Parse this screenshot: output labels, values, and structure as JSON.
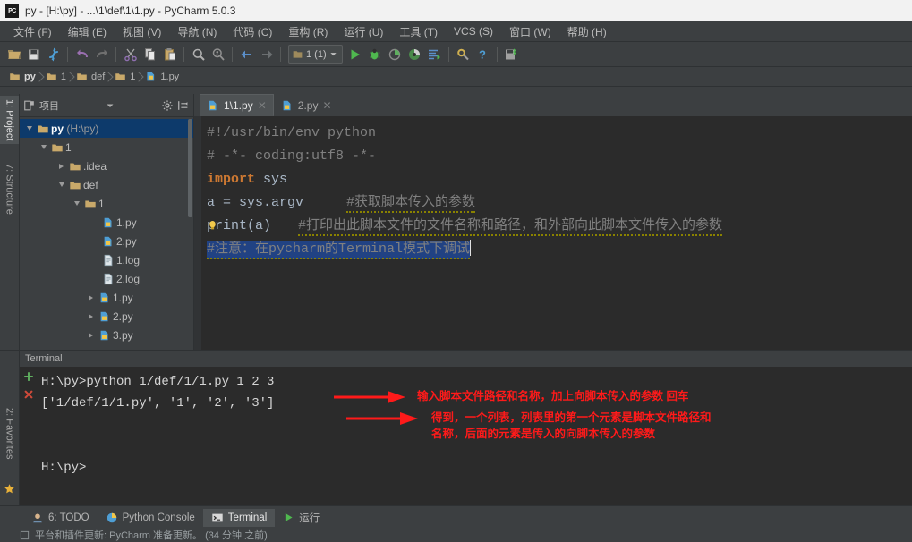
{
  "window": {
    "title": "py - [H:\\py] - ...\\1\\def\\1\\1.py - PyCharm 5.0.3",
    "logo_text": "PC"
  },
  "menu": {
    "items": [
      {
        "label": "文件 (F)",
        "name": "menu-file"
      },
      {
        "label": "编辑 (E)",
        "name": "menu-edit"
      },
      {
        "label": "视图 (V)",
        "name": "menu-view"
      },
      {
        "label": "导航 (N)",
        "name": "menu-navigate"
      },
      {
        "label": "代码 (C)",
        "name": "menu-code"
      },
      {
        "label": "重构 (R)",
        "name": "menu-refactor"
      },
      {
        "label": "运行 (U)",
        "name": "menu-run"
      },
      {
        "label": "工具 (T)",
        "name": "menu-tools"
      },
      {
        "label": "VCS (S)",
        "name": "menu-vcs"
      },
      {
        "label": "窗口 (W)",
        "name": "menu-window"
      },
      {
        "label": "帮助 (H)",
        "name": "menu-help"
      }
    ]
  },
  "toolbar": {
    "run_config_label": "1 (1)",
    "icons": [
      "open-folder-icon",
      "save-all-icon",
      "sync-icon",
      "undo-icon",
      "redo-icon",
      "cut-icon",
      "copy-icon",
      "paste-icon",
      "find-icon",
      "find-usages-icon",
      "back-icon",
      "forward-icon"
    ],
    "run_icons": [
      "run-icon",
      "debug-icon",
      "coverage-icon",
      "profile-icon",
      "run-with-console-icon",
      "settings-icon",
      "help-icon",
      "update-icon"
    ]
  },
  "breadcrumb": {
    "items": [
      {
        "label": "py",
        "icon": "folder-icon",
        "bold": true
      },
      {
        "label": "1",
        "icon": "folder-icon",
        "bold": false
      },
      {
        "label": "def",
        "icon": "folder-icon",
        "bold": false
      },
      {
        "label": "1",
        "icon": "folder-icon",
        "bold": false
      },
      {
        "label": "1.py",
        "icon": "python-file-icon",
        "bold": false
      }
    ]
  },
  "left_strip": {
    "tabs": [
      {
        "label": "1: Project",
        "selected": true,
        "name": "tool-tab-project"
      },
      {
        "label": "7: Structure",
        "selected": false,
        "name": "tool-tab-structure"
      },
      {
        "label": "2: Favorites",
        "selected": false,
        "name": "tool-tab-favorites"
      }
    ]
  },
  "project_panel": {
    "title": "项目",
    "tree": [
      {
        "label": "py",
        "suffix": " (H:\\py)",
        "depth": 0,
        "arrow": "open",
        "icon": "folder-icon",
        "selected": true,
        "bold": true
      },
      {
        "label": "1",
        "suffix": "",
        "depth": 1,
        "arrow": "open",
        "icon": "folder-icon",
        "selected": false,
        "bold": false
      },
      {
        "label": ".idea",
        "suffix": "",
        "depth": 2,
        "arrow": "closed",
        "icon": "folder-icon",
        "selected": false,
        "bold": false
      },
      {
        "label": "def",
        "suffix": "",
        "depth": 2,
        "arrow": "open",
        "icon": "folder-icon",
        "selected": false,
        "bold": false
      },
      {
        "label": "1",
        "suffix": "",
        "depth": 3,
        "arrow": "open",
        "icon": "folder-icon",
        "selected": false,
        "bold": false
      },
      {
        "label": "1.py",
        "suffix": "",
        "depth": 4,
        "arrow": "none",
        "icon": "python-file-icon",
        "selected": false,
        "bold": false
      },
      {
        "label": "2.py",
        "suffix": "",
        "depth": 4,
        "arrow": "none",
        "icon": "python-file-icon",
        "selected": false,
        "bold": false
      },
      {
        "label": "1.log",
        "suffix": "",
        "depth": 4,
        "arrow": "none",
        "icon": "text-file-icon",
        "selected": false,
        "bold": false
      },
      {
        "label": "2.log",
        "suffix": "",
        "depth": 4,
        "arrow": "none",
        "icon": "text-file-icon",
        "selected": false,
        "bold": false
      },
      {
        "label": "1.py",
        "suffix": "",
        "depth": 3,
        "arrow": "closed",
        "icon": "python-file-icon",
        "selected": false,
        "bold": false
      },
      {
        "label": "2.py",
        "suffix": "",
        "depth": 3,
        "arrow": "closed",
        "icon": "python-file-icon",
        "selected": false,
        "bold": false
      },
      {
        "label": "3.py",
        "suffix": "",
        "depth": 3,
        "arrow": "closed",
        "icon": "python-file-icon",
        "selected": false,
        "bold": false
      }
    ]
  },
  "editor": {
    "tabs": [
      {
        "label": "1\\1.py",
        "active": true,
        "name": "editor-tab-1"
      },
      {
        "label": "2.py",
        "active": false,
        "name": "editor-tab-2"
      }
    ],
    "code": {
      "line1": "#!/usr/bin/env python",
      "line2": "# -*- coding:utf8 -*-",
      "line3_kw": "import",
      "line3_rest": " sys",
      "line4": "a = sys.argv",
      "line4_comment": "#获取脚本传入的参数",
      "line5": "print(a)",
      "line5_comment": "#打印出此脚本文件的文件名称和路径，和外部向此脚本文件传入的参数",
      "line6_comment": "#注意：在pycharm的Terminal模式下调试"
    }
  },
  "terminal": {
    "title": "Terminal",
    "lines": [
      "H:\\py>python 1/def/1/1.py 1 2 3",
      "['1/def/1/1.py', '1', '2', '3']",
      "",
      "",
      "H:\\py>"
    ],
    "annotations": [
      {
        "text": "输入脚本文件路径和名称，加上向脚本传入的参数 回车",
        "name": "annotation-input-command"
      },
      {
        "text": "得到，一个列表，列表里的第一个元素是脚本文件路径和",
        "name": "annotation-result-line1"
      },
      {
        "text": "名称，后面的元素是传入的向脚本传入的参数",
        "name": "annotation-result-line2"
      }
    ],
    "colors": {
      "annotation": "#ff1a1a"
    }
  },
  "status_bar": {
    "buttons": [
      {
        "label": "6: TODO",
        "icon": "todo-icon",
        "selected": false,
        "name": "status-tab-todo"
      },
      {
        "label": "Python Console",
        "icon": "python-console-icon",
        "selected": false,
        "name": "status-tab-python-console"
      },
      {
        "label": "Terminal",
        "icon": "terminal-icon",
        "selected": true,
        "name": "status-tab-terminal"
      },
      {
        "label": "运行",
        "icon": "run-icon",
        "selected": false,
        "name": "status-tab-run"
      }
    ]
  },
  "info_bar": {
    "message": "平台和插件更新: PyCharm 准备更新。 (34 分钟 之前)"
  }
}
